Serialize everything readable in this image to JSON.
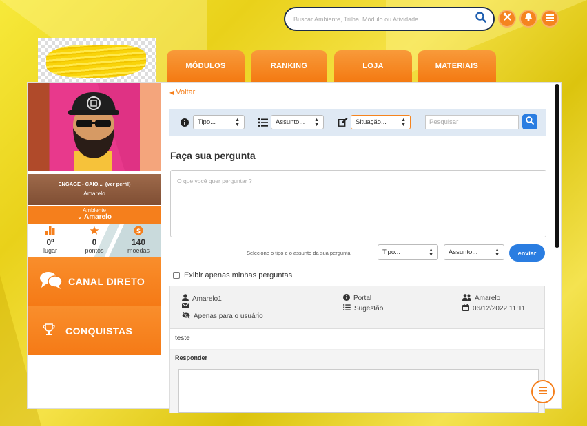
{
  "header": {
    "search_placeholder": "Buscar Ambiente, Trilha, Módulo ou Atividade"
  },
  "tabs": [
    {
      "label": "MÓDULOS"
    },
    {
      "label": "RANKING"
    },
    {
      "label": "LOJA"
    },
    {
      "label": "MATERIAIS"
    }
  ],
  "profile": {
    "name_line": "ENGAGE - CAIO...",
    "profile_link": "(ver perfil)",
    "subtitle": "Amarelo",
    "env_label": "Ambiente",
    "env_value": "Amarelo"
  },
  "stats": [
    {
      "value": "0º",
      "label": "lugar"
    },
    {
      "value": "0",
      "label": "pontos"
    },
    {
      "value": "140",
      "label": "moedas"
    }
  ],
  "sidebar": {
    "canal_direto": "CANAL DIRETO",
    "conquistas": "CONQUISTAS"
  },
  "content": {
    "back": "Voltar",
    "filters": {
      "tipo": "Tipo...",
      "assunto": "Assunto...",
      "situacao": "Situação...",
      "search_placeholder": "Pesquisar"
    },
    "heading": "Faça sua pergunta",
    "question_placeholder": "O que você quer perguntar ?",
    "hint": "Selecione o tipo e o assunto da sua pergunta:",
    "select_tipo": "Tipo...",
    "select_assunto": "Assunto...",
    "send": "enviar",
    "only_mine": "Exibir apenas minhas perguntas"
  },
  "question": {
    "user": "Amarelo1",
    "visibility": "Apenas para o usuário",
    "channel": "Portal",
    "type": "Sugestão",
    "group": "Amarelo",
    "date": "06/12/2022 11:11",
    "text": "teste",
    "reply_label": "Responder"
  },
  "colors": {
    "accent": "#f57f1c",
    "primary_blue": "#2a7de1",
    "navy": "#1b2c4a",
    "filter_bg": "#dfe9f4"
  }
}
